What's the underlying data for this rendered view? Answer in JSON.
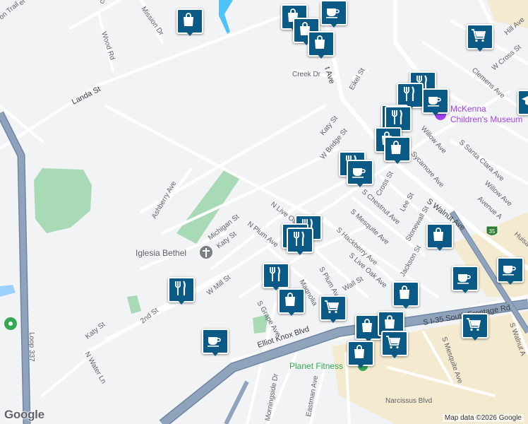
{
  "map": {
    "streets": [
      "Landa St",
      "Wood Rd",
      "Mission Dr",
      "Ashberry Ave",
      "Michigan St",
      "Katy St",
      "N Plum Ave",
      "N Live Oak",
      "W Mill St",
      "2nd St",
      "Katy St",
      "N Water Ln",
      "S Grape Ave",
      "Magnolia",
      "S Plum Ave",
      "S Live Oak Ave",
      "S Hackberry Ave",
      "S Mesquite Ave",
      "S Chestnut Ave",
      "Cross St",
      "Lee St",
      "Stonewall St",
      "S Walnut Ave",
      "Jackson St",
      "Sycamore Ave",
      "Willow Ave",
      "Avenue A",
      "S Santa Clara Ave",
      "Clemens Ave",
      "W Cross St",
      "Hill Ave",
      "Eikel St",
      "Creek Dr",
      "W Bridge St",
      "Elliot Knox Blvd",
      "S I-35 South Frontage Rd",
      "S Walnut A",
      "S Mesquite Ave",
      "Narcissus Blvd",
      "Morningside Dr",
      "Eastman Ave",
      "Loop 337",
      "Katy St",
      "Huisa",
      "Willow Ave",
      "Wall St"
    ],
    "places": {
      "iglesia": "Iglesia Bethel",
      "mckenna_line1": "McKenna",
      "mckenna_line2": "Children's Museum",
      "planet_fitness": "Planet Fitness"
    },
    "shields": {
      "i35": "35"
    },
    "attribution": "Map data ©2026 Google",
    "logo": "Google",
    "colors": {
      "background": "#f2f3f5",
      "park": "#a8dab5",
      "highway": "#8fa3bd",
      "highway_border": "#6f86a3",
      "commercial": "#f3ead0",
      "pin": "#0b5a86",
      "water": "#9cd1ff"
    }
  },
  "markers": [
    {
      "icon": "shopping-bag-icon"
    },
    {
      "icon": "shopping-bag-icon"
    },
    {
      "icon": "coffee-cup-icon"
    },
    {
      "icon": "shopping-bag-icon"
    },
    {
      "icon": "shopping-bag-icon"
    },
    {
      "icon": "shopping-cart-icon"
    },
    {
      "icon": "restaurant-icon"
    },
    {
      "icon": "restaurant-icon"
    },
    {
      "icon": "coffee-cup-icon"
    },
    {
      "icon": "graduation-cap-icon"
    },
    {
      "icon": "restaurant-icon"
    },
    {
      "icon": "restaurant-icon"
    },
    {
      "icon": "shopping-bag-icon"
    },
    {
      "icon": "shopping-bag-icon"
    },
    {
      "icon": "restaurant-icon"
    },
    {
      "icon": "coffee-cup-icon"
    },
    {
      "icon": "restaurant-icon"
    },
    {
      "icon": "restaurant-icon"
    },
    {
      "icon": "restaurant-icon"
    },
    {
      "icon": "shopping-bag-icon"
    },
    {
      "icon": "restaurant-icon"
    },
    {
      "icon": "restaurant-icon"
    },
    {
      "icon": "shopping-bag-icon"
    },
    {
      "icon": "shopping-cart-icon"
    },
    {
      "icon": "shopping-bag-icon"
    },
    {
      "icon": "coffee-cup-icon"
    },
    {
      "icon": "coffee-cup-icon"
    },
    {
      "icon": "shopping-bag-icon"
    },
    {
      "icon": "shopping-bag-icon"
    },
    {
      "icon": "shopping-cart-icon"
    },
    {
      "icon": "shopping-cart-icon"
    },
    {
      "icon": "shopping-bag-icon"
    },
    {
      "icon": "coffee-cup-icon"
    }
  ]
}
